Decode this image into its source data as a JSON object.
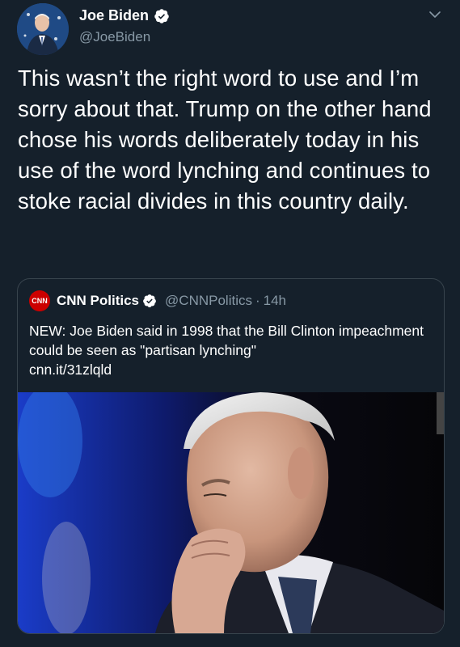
{
  "author": {
    "display_name": "Joe Biden",
    "handle": "@JoeBiden",
    "verified": true,
    "avatar_icon": "avatar-photo-icon"
  },
  "menu_icon": "chevron-down-icon",
  "tweet": {
    "text": "This wasn’t the right word to use and I’m sorry about that. Trump on the other hand chose his words deliberately today in his use of the word lynching and continues to stoke racial divides in this country daily."
  },
  "quoted_tweet": {
    "logo_text": "CNN",
    "display_name": "CNN Politics",
    "handle": "@CNNPolitics",
    "separator": "·",
    "time": "14h",
    "text": "NEW: Joe Biden said in 1998 that the Bill Clinton impeachment could be seen as \"partisan lynching\"",
    "link": "cnn.it/31zlqld",
    "image_icon": "news-photo-icon"
  },
  "colors": {
    "background": "#15202b",
    "secondary_text": "#8899a6",
    "border": "#38444d",
    "verified_badge": "#ffffff",
    "cnn_red": "#cc0000"
  }
}
